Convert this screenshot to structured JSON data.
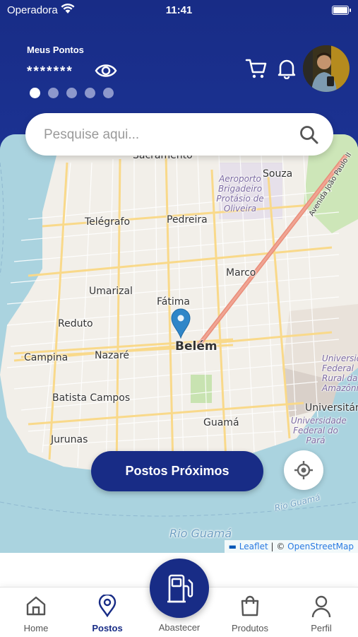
{
  "status_bar": {
    "carrier": "Operadora",
    "time": "11:41"
  },
  "header": {
    "points_label": "Meus Pontos",
    "points_value": "*******",
    "carousel_pages": 5,
    "carousel_active": 0
  },
  "search": {
    "placeholder": "Pesquise aqui..."
  },
  "map": {
    "labels": {
      "sacramento": "Sacramento",
      "souza": "Souza",
      "aeroporto": "Aeroporto Brigadeiro Protásio de Oliveira",
      "avenida": "Avenida João Paulo II",
      "telegrafo": "Telégrafo",
      "pedreira": "Pedreira",
      "marco": "Marco",
      "umarizal": "Umarizal",
      "fatima": "Fátima",
      "reduto": "Reduto",
      "belem": "Belém",
      "campina": "Campina",
      "nazare": "Nazaré",
      "universidade_rural": "Universidade Federal Rural da Amazônia",
      "batista_campos": "Batista Campos",
      "universitario": "Universitár",
      "guama": "Guamá",
      "universidade_para": "Universidade Federal do Pará",
      "jurunas": "Jurunas",
      "rio_guama_small": "Rio Guamá",
      "rio_guama": "Rio Guamá"
    },
    "attribution": {
      "leaflet": "Leaflet",
      "separator": " | © ",
      "osm": "OpenStreetMap"
    }
  },
  "actions": {
    "nearby_button": "Postos Próximos"
  },
  "tabs": [
    {
      "label": "Home",
      "icon": "home-icon"
    },
    {
      "label": "Postos",
      "icon": "map-pin-icon",
      "active": true
    },
    {
      "label": "Abastecer",
      "icon": "fuel-pump-icon"
    },
    {
      "label": "Produtos",
      "icon": "shopping-bag-icon"
    },
    {
      "label": "Perfil",
      "icon": "user-icon"
    }
  ],
  "colors": {
    "primary": "#182c86",
    "map_water": "#aad3df",
    "map_land": "#f2efe9",
    "road_major": "#f9d98a",
    "road_trunk": "#e98d79",
    "pin": "#2f86c8"
  }
}
